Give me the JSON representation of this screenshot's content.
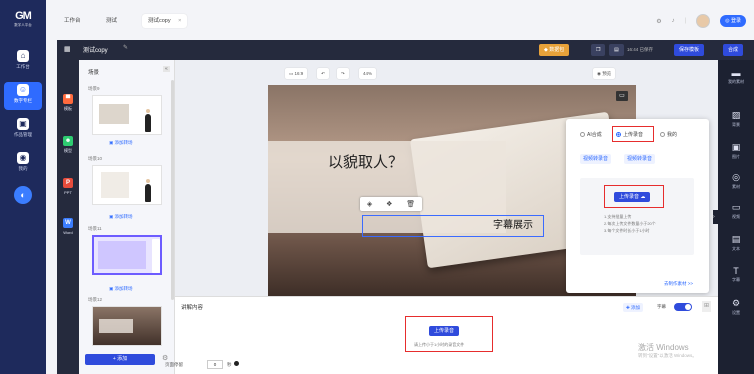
{
  "nav": {
    "logo": "GM",
    "logo_sub": "数字人平台",
    "items": [
      {
        "label": "工作台",
        "icon": "home-icon"
      },
      {
        "label": "数字专栏",
        "icon": "digital-human-icon"
      },
      {
        "label": "作品管理",
        "icon": "works-icon"
      },
      {
        "label": "我的",
        "icon": "user-icon"
      }
    ]
  },
  "tabs": {
    "t1": "工作台",
    "t2": "测试",
    "t3": "测试copy",
    "close": "×"
  },
  "header": {
    "title": "测试copy",
    "btn_vip": "数据包",
    "save_status": "16:44 已保存",
    "btn_save_template": "保存模板",
    "btn_compose": "合成"
  },
  "left_tools": [
    {
      "label": "模板",
      "color": "#ff6a3d"
    },
    {
      "label": "模型",
      "color": "#2ecc71"
    },
    {
      "label": "PPT",
      "color": "#e74c3c"
    },
    {
      "label": "Word",
      "color": "#3b7dff"
    }
  ],
  "scenes": {
    "title": "场景",
    "items": [
      {
        "label": "场景9",
        "add": "添加转场"
      },
      {
        "label": "场景10",
        "add": "添加转场"
      },
      {
        "label": "场景11",
        "add": "添加转场"
      },
      {
        "label": "场景12",
        "add": ""
      }
    ],
    "add_button": "+ 添加"
  },
  "canvas_toolbar": {
    "ratio": "16:9",
    "zoom": "44%",
    "preview": "预览"
  },
  "slide": {
    "quote": "以貌取人？",
    "subtitle": "字幕展示"
  },
  "audio_popover": {
    "opt_ai": "AI合成",
    "opt_upload": "上传录音",
    "opt_mine": "我的",
    "chip1": "视频转录音",
    "chip2": "视频转录音",
    "upload_btn": "上传录音",
    "tips": [
      "1.支持批量上传",
      "2.每次上传文件数量小于20个",
      "3.每个文件时长小于1小时"
    ],
    "more": "去制作素材 >>"
  },
  "narration": {
    "title": "讲解内容",
    "subtitle_label": "字幕",
    "add_label": "添加",
    "upload_btn": "上传录音",
    "hint": "请上传小于1小时的录音文件",
    "duration_label": "页面停留",
    "duration_value": "0",
    "duration_unit": "秒"
  },
  "right_panel": [
    {
      "label": "我的素材",
      "icon": "folder-icon"
    },
    {
      "label": "背景",
      "icon": "background-icon"
    },
    {
      "label": "图片",
      "icon": "image-icon"
    },
    {
      "label": "素材",
      "icon": "element-icon"
    },
    {
      "label": "视频",
      "icon": "video-icon"
    },
    {
      "label": "文本",
      "icon": "text-icon"
    },
    {
      "label": "字幕",
      "icon": "subtitle-icon"
    },
    {
      "label": "设置",
      "icon": "settings-icon"
    }
  ],
  "watermark": {
    "line1": "激活 Windows",
    "line2": "转到\"设置\"以激活 Windows。"
  },
  "colors": {
    "accent": "#2f6bff",
    "nav_bg": "#1e2a5c",
    "editor_bg": "#252a3d",
    "highlight_red": "#e62d2d"
  }
}
